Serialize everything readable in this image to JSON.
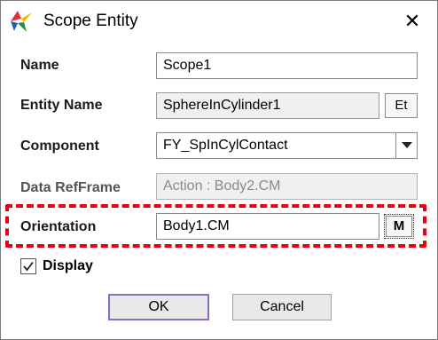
{
  "dialog": {
    "title": "Scope Entity",
    "close_glyph": "✕",
    "icon": "app-logo-icon"
  },
  "form": {
    "name": {
      "label": "Name",
      "value": "Scope1"
    },
    "entity_name": {
      "label": "Entity Name",
      "value": "SphereInCylinder1",
      "button_label": "Et"
    },
    "component": {
      "label": "Component",
      "value": "FY_SpInCylContact",
      "arrow_icon": "chevron-down-icon"
    },
    "data_ref_frame": {
      "label": "Data RefFrame",
      "value": "Action : Body2.CM"
    },
    "orientation": {
      "label": "Orientation",
      "value": "Body1.CM",
      "button_label": "M"
    }
  },
  "display": {
    "label": "Display",
    "checked": true
  },
  "buttons": {
    "ok": "OK",
    "cancel": "Cancel"
  },
  "colors": {
    "highlight": "#e60012",
    "default_button_border": "#8c6bc7"
  }
}
